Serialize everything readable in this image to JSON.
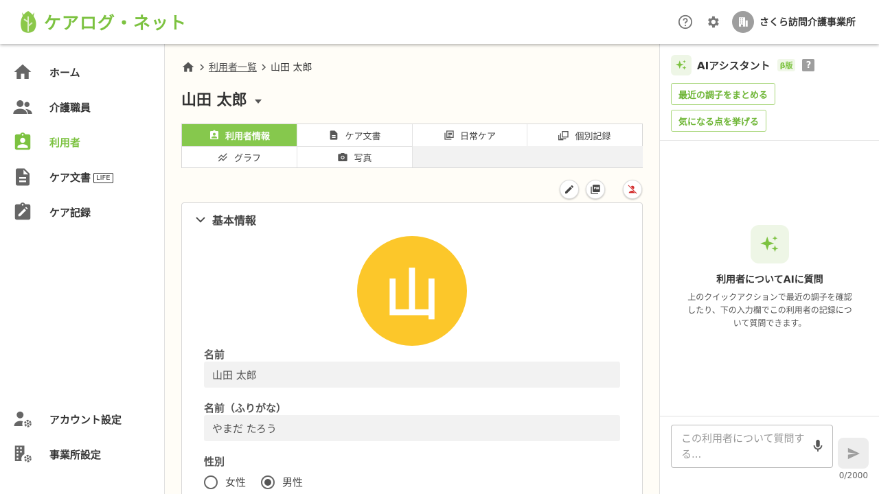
{
  "header": {
    "app_name": "ケアログ・ネット",
    "org_name": "さくら訪問介護事業所",
    "icons": [
      "help-icon",
      "gear-icon",
      "building-icon"
    ]
  },
  "sidebar": {
    "items": [
      {
        "label": "ホーム",
        "icon": "home-icon"
      },
      {
        "label": "介護職員",
        "icon": "people-icon"
      },
      {
        "label": "利用者",
        "icon": "assignment-ind-icon",
        "active": true
      },
      {
        "label": "ケア文書",
        "icon": "document-icon",
        "badge": "LIFE"
      },
      {
        "label": "ケア記録",
        "icon": "edit-note-icon"
      }
    ],
    "bottom_items": [
      {
        "label": "アカウント設定",
        "icon": "account-settings-icon"
      },
      {
        "label": "事業所設定",
        "icon": "office-settings-icon"
      }
    ]
  },
  "main": {
    "breadcrumb": {
      "link": "利用者一覧",
      "current": "山田 太郎"
    },
    "title": "山田 太郎",
    "tabs": [
      {
        "label": "利用者情報",
        "icon": "badge-icon",
        "active": true
      },
      {
        "label": "ケア文書",
        "icon": "document-icon"
      },
      {
        "label": "日常ケア",
        "icon": "library-icon"
      },
      {
        "label": "個別記録",
        "icon": "records-icon"
      },
      {
        "label": "グラフ",
        "icon": "graph-icon"
      },
      {
        "label": "写真",
        "icon": "camera-icon"
      }
    ],
    "section": {
      "title": "基本情報",
      "avatar_initial": "山",
      "avatar_color": "#fcc72a",
      "fields": [
        {
          "label": "名前",
          "value": "山田 太郎"
        },
        {
          "label": "名前（ふりがな）",
          "value": "やまだ たろう"
        }
      ],
      "gender": {
        "label": "性別",
        "options": [
          "女性",
          "男性"
        ],
        "selected": "男性"
      }
    }
  },
  "assistant": {
    "title": "AIアシスタント",
    "beta": "β版",
    "help": "?",
    "quick_actions": [
      "最近の調子をまとめる",
      "気になる点を挙げる"
    ],
    "empty_title": "利用者についてAIに質問",
    "empty_desc": "上のクイックアクションで最近の調子を確認したり、下の入力欄でこの利用者の記録について質問できます。",
    "input_placeholder": "この利用者について質問する...",
    "counter": "0/2000"
  },
  "colors": {
    "accent": "#7cc240",
    "tab_active": "#86c84d",
    "avatar": "#fcc72a"
  }
}
